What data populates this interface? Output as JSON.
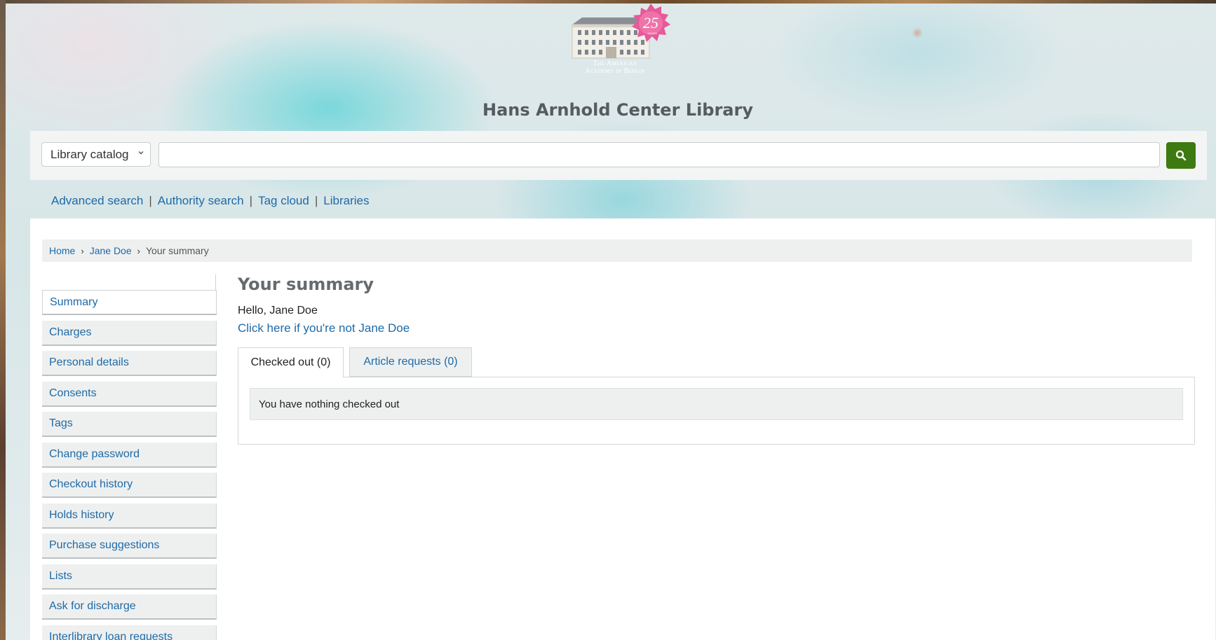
{
  "header": {
    "logo_badge": "25",
    "logo_badge_small": "YEARS",
    "logo_text_line1": "The American",
    "logo_text_line2": "Academy in Berlin",
    "site_title": "Hans Arnhold Center Library"
  },
  "search": {
    "scope_selected": "Library catalog",
    "query_value": "",
    "button_icon": "search-icon"
  },
  "more_links": {
    "advanced": "Advanced search",
    "authority": "Authority search",
    "tag_cloud": "Tag cloud",
    "libraries": "Libraries",
    "separator": "|"
  },
  "breadcrumb": {
    "home": "Home",
    "user": "Jane Doe",
    "current": "Your summary",
    "separator": "›"
  },
  "sidebar": {
    "items": [
      {
        "label": "Summary",
        "active": true
      },
      {
        "label": "Charges"
      },
      {
        "label": "Personal details"
      },
      {
        "label": "Consents"
      },
      {
        "label": "Tags"
      },
      {
        "label": "Change password"
      },
      {
        "label": "Checkout history"
      },
      {
        "label": "Holds history"
      },
      {
        "label": "Purchase suggestions"
      },
      {
        "label": "Lists"
      },
      {
        "label": "Ask for discharge"
      },
      {
        "label": "Interlibrary loan requests"
      }
    ]
  },
  "main": {
    "heading": "Your summary",
    "greeting": "Hello, Jane Doe",
    "not_you_link": "Click here if you're not Jane Doe",
    "tabs": [
      {
        "label": "Checked out (0)",
        "active": true
      },
      {
        "label": "Article requests (0)"
      }
    ],
    "empty_message": "You have nothing checked out"
  },
  "colors": {
    "link": "#1e6aa7",
    "search_button": "#3d7a12",
    "badge": "#e8589a"
  }
}
